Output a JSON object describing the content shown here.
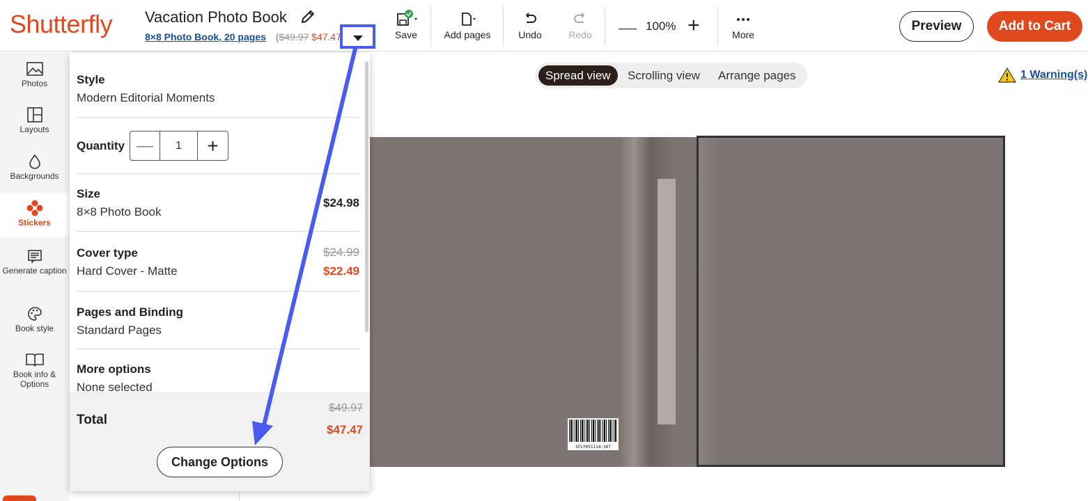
{
  "header": {
    "logo": "Shutterfly",
    "title": "Vacation Photo Book",
    "product_link": "8×8 Photo Book, 20 pages",
    "price_open": "(",
    "price_original": "$49.97",
    "price_sale": "$47.47",
    "price_close": ")",
    "tools": {
      "save": "Save",
      "add_pages": "Add pages",
      "undo": "Undo",
      "redo": "Redo",
      "zoom": "100%",
      "more": "More"
    },
    "preview": "Preview",
    "add_to_cart": "Add to Cart"
  },
  "sidebar": {
    "items": [
      {
        "label": "Photos",
        "icon": "image-icon"
      },
      {
        "label": "Layouts",
        "icon": "layout-icon"
      },
      {
        "label": "Backgrounds",
        "icon": "droplet-icon"
      },
      {
        "label": "Stickers",
        "icon": "sticker-icon"
      },
      {
        "label": "Generate caption",
        "icon": "caption-icon"
      },
      {
        "label": "Book style",
        "icon": "palette-icon"
      },
      {
        "label": "Book info & Options",
        "icon": "book-icon"
      }
    ],
    "active": "Stickers"
  },
  "view_toggle": {
    "options": [
      "Spread view",
      "Scrolling view",
      "Arrange pages"
    ],
    "active": "Spread view"
  },
  "warning": "1 Warning(s)",
  "book": {
    "barcode_text": "SFLY051114-347"
  },
  "options_panel": {
    "style_label": "Style",
    "style_value": "Modern Editorial Moments",
    "quantity_label": "Quantity",
    "quantity_value": "1",
    "size_label": "Size",
    "size_value": "8×8 Photo Book",
    "size_price": "$24.98",
    "cover_label": "Cover type",
    "cover_value": "Hard Cover - Matte",
    "cover_price_original": "$24.99",
    "cover_price_sale": "$22.49",
    "pages_label": "Pages and Binding",
    "pages_value": "Standard Pages",
    "more_label": "More options",
    "more_value": "None selected",
    "total_label": "Total",
    "total_original": "$49.97",
    "total_sale": "$47.47",
    "change_button": "Change Options"
  },
  "colors": {
    "brand": "#e0491d",
    "link": "#1a4fa0",
    "annotation": "#4a5cf0",
    "cover": "#7e7471"
  }
}
